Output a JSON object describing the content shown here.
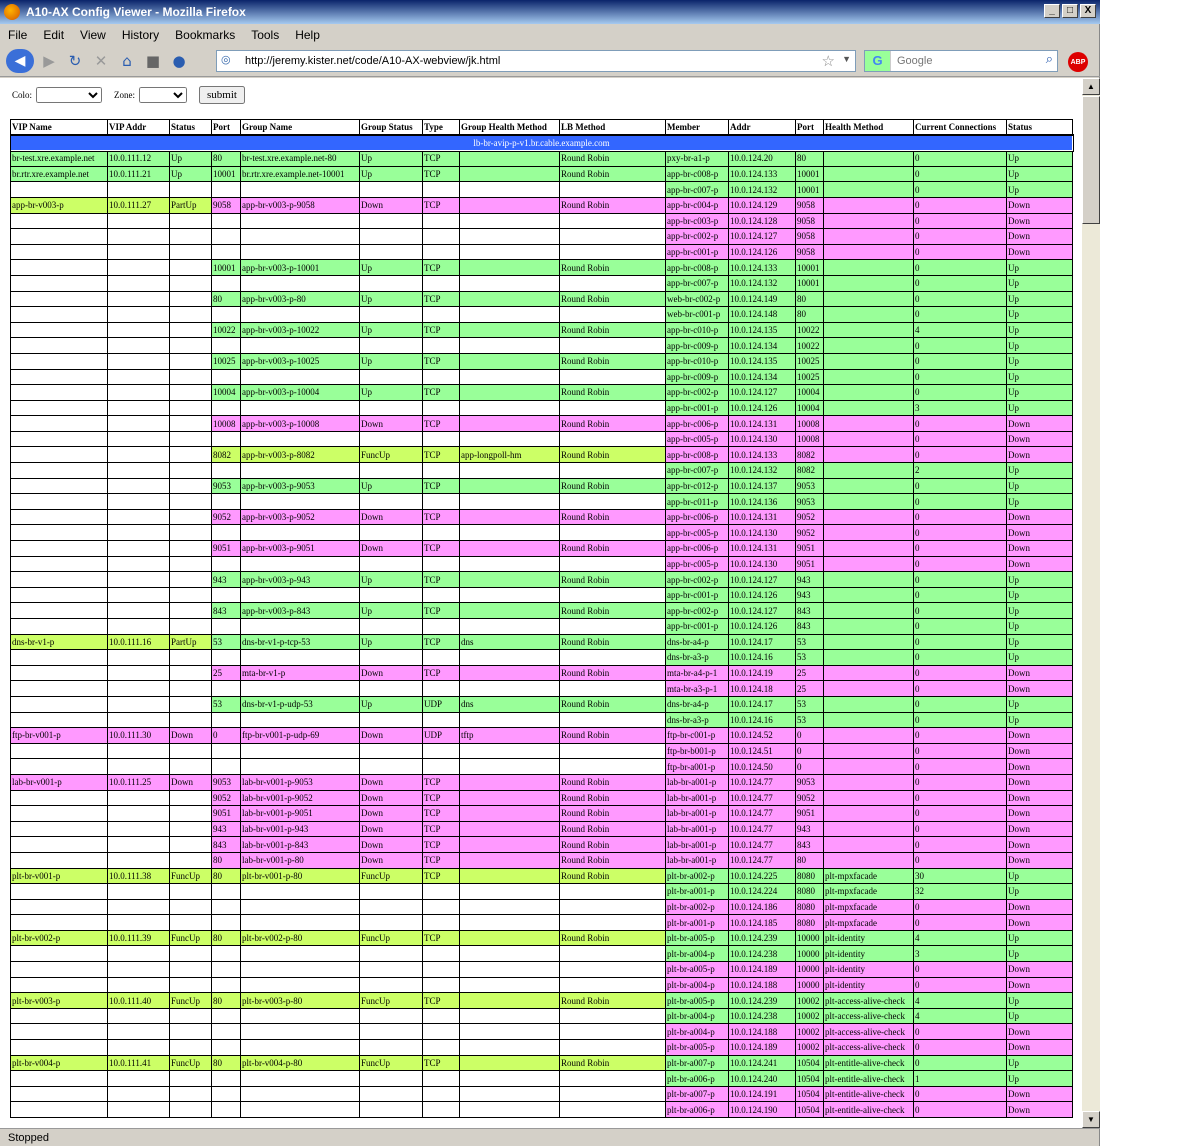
{
  "window": {
    "title": "A10-AX Config Viewer - Mozilla Firefox",
    "min": "_",
    "max": "□",
    "close": "X"
  },
  "menu": [
    "File",
    "Edit",
    "View",
    "History",
    "Bookmarks",
    "Tools",
    "Help"
  ],
  "nav": {
    "url": "http://jeremy.kister.net/code/A10-AX-webview/jk.html",
    "search_placeholder": "Google",
    "abp": "ABP"
  },
  "status": "Stopped",
  "filters": {
    "colo_label": "Colo:",
    "zone_label": "Zone:",
    "submit": "submit"
  },
  "columns": [
    "VIP Name",
    "VIP Addr",
    "Status",
    "Port",
    "Group Name",
    "Group Status",
    "Type",
    "Group Health Method",
    "LB Method",
    "Member",
    "Addr",
    "Port",
    "Health Method",
    "Current Connections",
    "Status"
  ],
  "section_header": "lb-br-avip-p-v1.br.cable.example.com",
  "colors": {
    "up": "#99ff99",
    "down": "#ff99ff",
    "partial": "#ccff66",
    "header": "#3366ff"
  },
  "rows": [
    [
      "br-test.xre.example.net",
      "10.0.111.12",
      "Up",
      "80",
      "br-test.xre.example.net-80",
      "Up",
      "TCP",
      "",
      "Round Robin",
      "pxy-br-a1-p",
      "10.0.124.20",
      "80",
      "",
      "0",
      "Up"
    ],
    [
      "br.rtr.xre.example.net",
      "10.0.111.21",
      "Up",
      "10001",
      "br.rtr.xre.example.net-10001",
      "Up",
      "TCP",
      "",
      "Round Robin",
      "app-br-c008-p",
      "10.0.124.133",
      "10001",
      "",
      "0",
      "Up"
    ],
    [
      "",
      "",
      "",
      "",
      "",
      "",
      "",
      "",
      "",
      "app-br-c007-p",
      "10.0.124.132",
      "10001",
      "",
      "0",
      "Up"
    ],
    [
      "app-br-v003-p",
      "10.0.111.27",
      "PartUp",
      "9058",
      "app-br-v003-p-9058",
      "Down",
      "TCP",
      "",
      "Round Robin",
      "app-br-c004-p",
      "10.0.124.129",
      "9058",
      "",
      "0",
      "Down"
    ],
    [
      "",
      "",
      "",
      "",
      "",
      "",
      "",
      "",
      "",
      "app-br-c003-p",
      "10.0.124.128",
      "9058",
      "",
      "0",
      "Down"
    ],
    [
      "",
      "",
      "",
      "",
      "",
      "",
      "",
      "",
      "",
      "app-br-c002-p",
      "10.0.124.127",
      "9058",
      "",
      "0",
      "Down"
    ],
    [
      "",
      "",
      "",
      "",
      "",
      "",
      "",
      "",
      "",
      "app-br-c001-p",
      "10.0.124.126",
      "9058",
      "",
      "0",
      "Down"
    ],
    [
      "",
      "",
      "",
      "10001",
      "app-br-v003-p-10001",
      "Up",
      "TCP",
      "",
      "Round Robin",
      "app-br-c008-p",
      "10.0.124.133",
      "10001",
      "",
      "0",
      "Up"
    ],
    [
      "",
      "",
      "",
      "",
      "",
      "",
      "",
      "",
      "",
      "app-br-c007-p",
      "10.0.124.132",
      "10001",
      "",
      "0",
      "Up"
    ],
    [
      "",
      "",
      "",
      "80",
      "app-br-v003-p-80",
      "Up",
      "TCP",
      "",
      "Round Robin",
      "web-br-c002-p",
      "10.0.124.149",
      "80",
      "",
      "0",
      "Up"
    ],
    [
      "",
      "",
      "",
      "",
      "",
      "",
      "",
      "",
      "",
      "web-br-c001-p",
      "10.0.124.148",
      "80",
      "",
      "0",
      "Up"
    ],
    [
      "",
      "",
      "",
      "10022",
      "app-br-v003-p-10022",
      "Up",
      "TCP",
      "",
      "Round Robin",
      "app-br-c010-p",
      "10.0.124.135",
      "10022",
      "",
      "4",
      "Up"
    ],
    [
      "",
      "",
      "",
      "",
      "",
      "",
      "",
      "",
      "",
      "app-br-c009-p",
      "10.0.124.134",
      "10022",
      "",
      "0",
      "Up"
    ],
    [
      "",
      "",
      "",
      "10025",
      "app-br-v003-p-10025",
      "Up",
      "TCP",
      "",
      "Round Robin",
      "app-br-c010-p",
      "10.0.124.135",
      "10025",
      "",
      "0",
      "Up"
    ],
    [
      "",
      "",
      "",
      "",
      "",
      "",
      "",
      "",
      "",
      "app-br-c009-p",
      "10.0.124.134",
      "10025",
      "",
      "0",
      "Up"
    ],
    [
      "",
      "",
      "",
      "10004",
      "app-br-v003-p-10004",
      "Up",
      "TCP",
      "",
      "Round Robin",
      "app-br-c002-p",
      "10.0.124.127",
      "10004",
      "",
      "0",
      "Up"
    ],
    [
      "",
      "",
      "",
      "",
      "",
      "",
      "",
      "",
      "",
      "app-br-c001-p",
      "10.0.124.126",
      "10004",
      "",
      "3",
      "Up"
    ],
    [
      "",
      "",
      "",
      "10008",
      "app-br-v003-p-10008",
      "Down",
      "TCP",
      "",
      "Round Robin",
      "app-br-c006-p",
      "10.0.124.131",
      "10008",
      "",
      "0",
      "Down"
    ],
    [
      "",
      "",
      "",
      "",
      "",
      "",
      "",
      "",
      "",
      "app-br-c005-p",
      "10.0.124.130",
      "10008",
      "",
      "0",
      "Down"
    ],
    [
      "",
      "",
      "",
      "8082",
      "app-br-v003-p-8082",
      "FuncUp",
      "TCP",
      "app-longpoll-hm",
      "Round Robin",
      "app-br-c008-p",
      "10.0.124.133",
      "8082",
      "",
      "0",
      "Down"
    ],
    [
      "",
      "",
      "",
      "",
      "",
      "",
      "",
      "",
      "",
      "app-br-c007-p",
      "10.0.124.132",
      "8082",
      "",
      "2",
      "Up"
    ],
    [
      "",
      "",
      "",
      "9053",
      "app-br-v003-p-9053",
      "Up",
      "TCP",
      "",
      "Round Robin",
      "app-br-c012-p",
      "10.0.124.137",
      "9053",
      "",
      "0",
      "Up"
    ],
    [
      "",
      "",
      "",
      "",
      "",
      "",
      "",
      "",
      "",
      "app-br-c011-p",
      "10.0.124.136",
      "9053",
      "",
      "0",
      "Up"
    ],
    [
      "",
      "",
      "",
      "9052",
      "app-br-v003-p-9052",
      "Down",
      "TCP",
      "",
      "Round Robin",
      "app-br-c006-p",
      "10.0.124.131",
      "9052",
      "",
      "0",
      "Down"
    ],
    [
      "",
      "",
      "",
      "",
      "",
      "",
      "",
      "",
      "",
      "app-br-c005-p",
      "10.0.124.130",
      "9052",
      "",
      "0",
      "Down"
    ],
    [
      "",
      "",
      "",
      "9051",
      "app-br-v003-p-9051",
      "Down",
      "TCP",
      "",
      "Round Robin",
      "app-br-c006-p",
      "10.0.124.131",
      "9051",
      "",
      "0",
      "Down"
    ],
    [
      "",
      "",
      "",
      "",
      "",
      "",
      "",
      "",
      "",
      "app-br-c005-p",
      "10.0.124.130",
      "9051",
      "",
      "0",
      "Down"
    ],
    [
      "",
      "",
      "",
      "943",
      "app-br-v003-p-943",
      "Up",
      "TCP",
      "",
      "Round Robin",
      "app-br-c002-p",
      "10.0.124.127",
      "943",
      "",
      "0",
      "Up"
    ],
    [
      "",
      "",
      "",
      "",
      "",
      "",
      "",
      "",
      "",
      "app-br-c001-p",
      "10.0.124.126",
      "943",
      "",
      "0",
      "Up"
    ],
    [
      "",
      "",
      "",
      "843",
      "app-br-v003-p-843",
      "Up",
      "TCP",
      "",
      "Round Robin",
      "app-br-c002-p",
      "10.0.124.127",
      "843",
      "",
      "0",
      "Up"
    ],
    [
      "",
      "",
      "",
      "",
      "",
      "",
      "",
      "",
      "",
      "app-br-c001-p",
      "10.0.124.126",
      "843",
      "",
      "0",
      "Up"
    ],
    [
      "dns-br-v1-p",
      "10.0.111.16",
      "PartUp",
      "53",
      "dns-br-v1-p-tcp-53",
      "Up",
      "TCP",
      "dns",
      "Round Robin",
      "dns-br-a4-p",
      "10.0.124.17",
      "53",
      "",
      "0",
      "Up"
    ],
    [
      "",
      "",
      "",
      "",
      "",
      "",
      "",
      "",
      "",
      "dns-br-a3-p",
      "10.0.124.16",
      "53",
      "",
      "0",
      "Up"
    ],
    [
      "",
      "",
      "",
      "25",
      "mta-br-v1-p",
      "Down",
      "TCP",
      "",
      "Round Robin",
      "mta-br-a4-p-1",
      "10.0.124.19",
      "25",
      "",
      "0",
      "Down"
    ],
    [
      "",
      "",
      "",
      "",
      "",
      "",
      "",
      "",
      "",
      "mta-br-a3-p-1",
      "10.0.124.18",
      "25",
      "",
      "0",
      "Down"
    ],
    [
      "",
      "",
      "",
      "53",
      "dns-br-v1-p-udp-53",
      "Up",
      "UDP",
      "dns",
      "Round Robin",
      "dns-br-a4-p",
      "10.0.124.17",
      "53",
      "",
      "0",
      "Up"
    ],
    [
      "",
      "",
      "",
      "",
      "",
      "",
      "",
      "",
      "",
      "dns-br-a3-p",
      "10.0.124.16",
      "53",
      "",
      "0",
      "Up"
    ],
    [
      "ftp-br-v001-p",
      "10.0.111.30",
      "Down",
      "0",
      "ftp-br-v001-p-udp-69",
      "Down",
      "UDP",
      "tftp",
      "Round Robin",
      "ftp-br-c001-p",
      "10.0.124.52",
      "0",
      "",
      "0",
      "Down"
    ],
    [
      "",
      "",
      "",
      "",
      "",
      "",
      "",
      "",
      "",
      "ftp-br-b001-p",
      "10.0.124.51",
      "0",
      "",
      "0",
      "Down"
    ],
    [
      "",
      "",
      "",
      "",
      "",
      "",
      "",
      "",
      "",
      "ftp-br-a001-p",
      "10.0.124.50",
      "0",
      "",
      "0",
      "Down"
    ],
    [
      "lab-br-v001-p",
      "10.0.111.25",
      "Down",
      "9053",
      "lab-br-v001-p-9053",
      "Down",
      "TCP",
      "",
      "Round Robin",
      "lab-br-a001-p",
      "10.0.124.77",
      "9053",
      "",
      "0",
      "Down"
    ],
    [
      "",
      "",
      "",
      "9052",
      "lab-br-v001-p-9052",
      "Down",
      "TCP",
      "",
      "Round Robin",
      "lab-br-a001-p",
      "10.0.124.77",
      "9052",
      "",
      "0",
      "Down"
    ],
    [
      "",
      "",
      "",
      "9051",
      "lab-br-v001-p-9051",
      "Down",
      "TCP",
      "",
      "Round Robin",
      "lab-br-a001-p",
      "10.0.124.77",
      "9051",
      "",
      "0",
      "Down"
    ],
    [
      "",
      "",
      "",
      "943",
      "lab-br-v001-p-943",
      "Down",
      "TCP",
      "",
      "Round Robin",
      "lab-br-a001-p",
      "10.0.124.77",
      "943",
      "",
      "0",
      "Down"
    ],
    [
      "",
      "",
      "",
      "843",
      "lab-br-v001-p-843",
      "Down",
      "TCP",
      "",
      "Round Robin",
      "lab-br-a001-p",
      "10.0.124.77",
      "843",
      "",
      "0",
      "Down"
    ],
    [
      "",
      "",
      "",
      "80",
      "lab-br-v001-p-80",
      "Down",
      "TCP",
      "",
      "Round Robin",
      "lab-br-a001-p",
      "10.0.124.77",
      "80",
      "",
      "0",
      "Down"
    ],
    [
      "plt-br-v001-p",
      "10.0.111.38",
      "FuncUp",
      "80",
      "plt-br-v001-p-80",
      "FuncUp",
      "TCP",
      "",
      "Round Robin",
      "plt-br-a002-p",
      "10.0.124.225",
      "8080",
      "plt-mpxfacade",
      "30",
      "Up"
    ],
    [
      "",
      "",
      "",
      "",
      "",
      "",
      "",
      "",
      "",
      "plt-br-a001-p",
      "10.0.124.224",
      "8080",
      "plt-mpxfacade",
      "32",
      "Up"
    ],
    [
      "",
      "",
      "",
      "",
      "",
      "",
      "",
      "",
      "",
      "plt-br-a002-p",
      "10.0.124.186",
      "8080",
      "plt-mpxfacade",
      "0",
      "Down"
    ],
    [
      "",
      "",
      "",
      "",
      "",
      "",
      "",
      "",
      "",
      "plt-br-a001-p",
      "10.0.124.185",
      "8080",
      "plt-mpxfacade",
      "0",
      "Down"
    ],
    [
      "plt-br-v002-p",
      "10.0.111.39",
      "FuncUp",
      "80",
      "plt-br-v002-p-80",
      "FuncUp",
      "TCP",
      "",
      "Round Robin",
      "plt-br-a005-p",
      "10.0.124.239",
      "10000",
      "plt-identity",
      "4",
      "Up"
    ],
    [
      "",
      "",
      "",
      "",
      "",
      "",
      "",
      "",
      "",
      "plt-br-a004-p",
      "10.0.124.238",
      "10000",
      "plt-identity",
      "3",
      "Up"
    ],
    [
      "",
      "",
      "",
      "",
      "",
      "",
      "",
      "",
      "",
      "plt-br-a005-p",
      "10.0.124.189",
      "10000",
      "plt-identity",
      "0",
      "Down"
    ],
    [
      "",
      "",
      "",
      "",
      "",
      "",
      "",
      "",
      "",
      "plt-br-a004-p",
      "10.0.124.188",
      "10000",
      "plt-identity",
      "0",
      "Down"
    ],
    [
      "plt-br-v003-p",
      "10.0.111.40",
      "FuncUp",
      "80",
      "plt-br-v003-p-80",
      "FuncUp",
      "TCP",
      "",
      "Round Robin",
      "plt-br-a005-p",
      "10.0.124.239",
      "10002",
      "plt-access-alive-check",
      "4",
      "Up"
    ],
    [
      "",
      "",
      "",
      "",
      "",
      "",
      "",
      "",
      "",
      "plt-br-a004-p",
      "10.0.124.238",
      "10002",
      "plt-access-alive-check",
      "4",
      "Up"
    ],
    [
      "",
      "",
      "",
      "",
      "",
      "",
      "",
      "",
      "",
      "plt-br-a004-p",
      "10.0.124.188",
      "10002",
      "plt-access-alive-check",
      "0",
      "Down"
    ],
    [
      "",
      "",
      "",
      "",
      "",
      "",
      "",
      "",
      "",
      "plt-br-a005-p",
      "10.0.124.189",
      "10002",
      "plt-access-alive-check",
      "0",
      "Down"
    ],
    [
      "plt-br-v004-p",
      "10.0.111.41",
      "FuncUp",
      "80",
      "plt-br-v004-p-80",
      "FuncUp",
      "TCP",
      "",
      "Round Robin",
      "plt-br-a007-p",
      "10.0.124.241",
      "10504",
      "plt-entitle-alive-check",
      "0",
      "Up"
    ],
    [
      "",
      "",
      "",
      "",
      "",
      "",
      "",
      "",
      "",
      "plt-br-a006-p",
      "10.0.124.240",
      "10504",
      "plt-entitle-alive-check",
      "1",
      "Up"
    ],
    [
      "",
      "",
      "",
      "",
      "",
      "",
      "",
      "",
      "",
      "plt-br-a007-p",
      "10.0.124.191",
      "10504",
      "plt-entitle-alive-check",
      "0",
      "Down"
    ],
    [
      "",
      "",
      "",
      "",
      "",
      "",
      "",
      "",
      "",
      "plt-br-a006-p",
      "10.0.124.190",
      "10504",
      "plt-entitle-alive-check",
      "0",
      "Down"
    ]
  ]
}
